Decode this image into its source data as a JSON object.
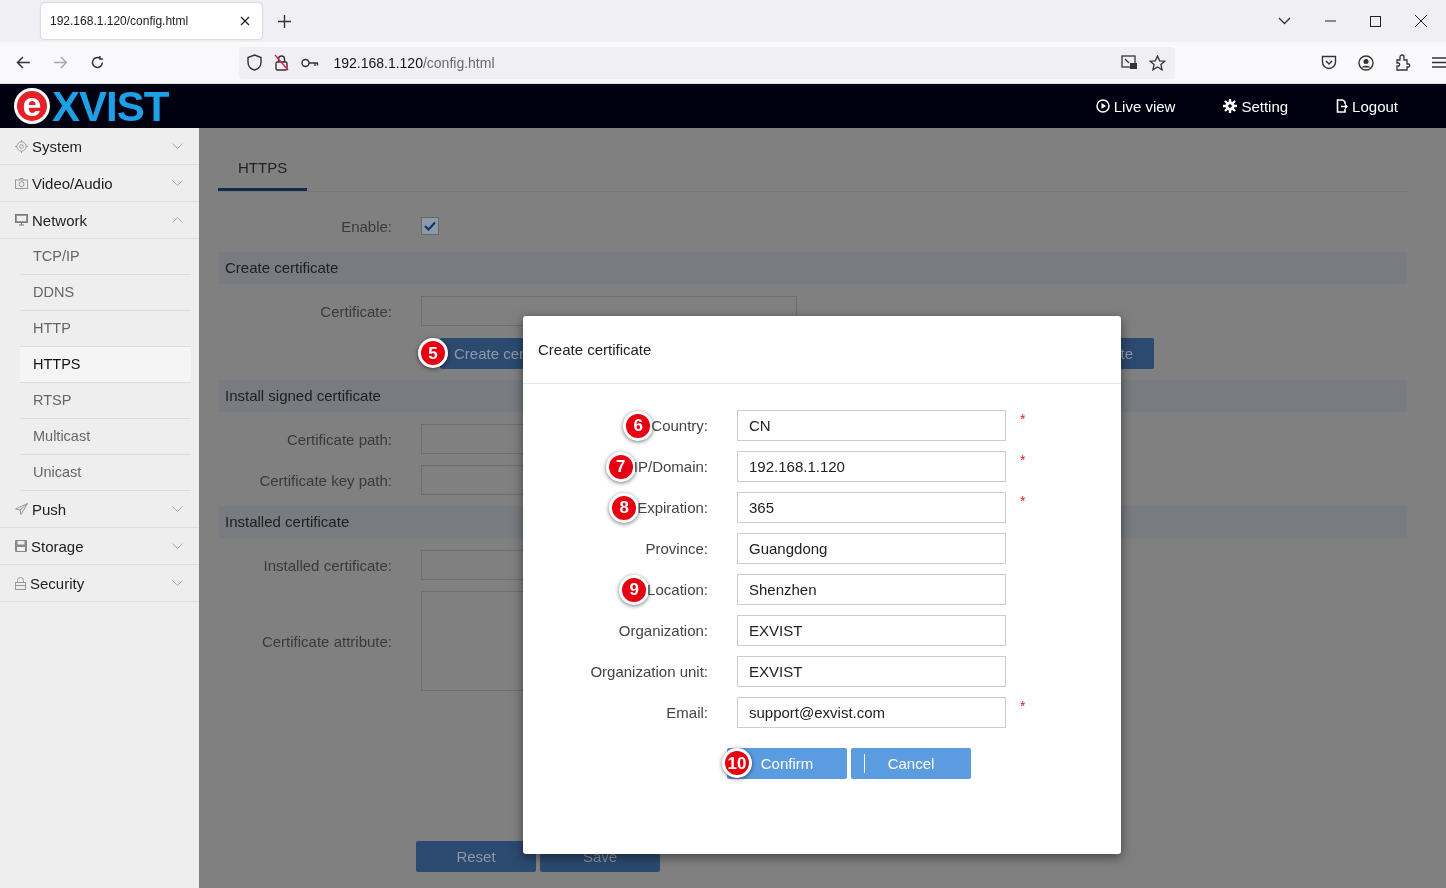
{
  "browser": {
    "tab_title": "192.168.1.120/config.html",
    "address_host": "192.168.1.120",
    "address_path": "/config.html"
  },
  "logo": {
    "mark": "e",
    "text": "XVIST"
  },
  "nav": [
    {
      "label": "Live view",
      "kind": "live"
    },
    {
      "label": "Setting",
      "kind": "setting"
    },
    {
      "label": "Logout",
      "kind": "logout"
    }
  ],
  "sidebar": [
    {
      "label": "System",
      "kind": "system",
      "expanded": false
    },
    {
      "label": "Video/Audio",
      "kind": "video",
      "expanded": false
    },
    {
      "label": "Network",
      "kind": "network",
      "expanded": true,
      "children": [
        {
          "label": "TCP/IP",
          "selected": false
        },
        {
          "label": "DDNS",
          "selected": false
        },
        {
          "label": "HTTP",
          "selected": false
        },
        {
          "label": "HTTPS",
          "selected": true
        },
        {
          "label": "RTSP",
          "selected": false
        },
        {
          "label": "Multicast",
          "selected": false
        },
        {
          "label": "Unicast",
          "selected": false
        }
      ]
    },
    {
      "label": "Push",
      "kind": "push",
      "expanded": false
    },
    {
      "label": "Storage",
      "kind": "storage",
      "expanded": false
    },
    {
      "label": "Security",
      "kind": "security",
      "expanded": false
    }
  ],
  "tabs": [
    {
      "label": "HTTPS",
      "selected": true
    }
  ],
  "enable": {
    "label": "Enable:",
    "checked": true
  },
  "sections": [
    {
      "title": "Create certificate",
      "rows": [
        {
          "label": "Certificate:",
          "kind": "input"
        }
      ],
      "buttons": [
        {
          "label": "Create cer",
          "badge": "5"
        },
        {
          "label": "te"
        }
      ]
    },
    {
      "title": "Install signed certificate",
      "rows": [
        {
          "label": "Certificate path:",
          "kind": "input"
        },
        {
          "label": "Certificate key path:",
          "kind": "input"
        }
      ]
    },
    {
      "title": "Installed certificate",
      "rows": [
        {
          "label": "Installed certificate:",
          "kind": "input"
        },
        {
          "label": "Certificate attribute:",
          "kind": "textarea"
        }
      ]
    }
  ],
  "footer_buttons": [
    "Reset",
    "Save"
  ],
  "dialog": {
    "title": "Create certificate",
    "fields": [
      {
        "label": "Country:",
        "value": "CN",
        "required": true,
        "badge": "6"
      },
      {
        "label": "IP/Domain:",
        "value": "192.168.1.120",
        "required": true,
        "badge": "7"
      },
      {
        "label": "Expiration:",
        "value": "365",
        "required": true,
        "badge": "8"
      },
      {
        "label": "Province:",
        "value": "Guangdong",
        "required": false
      },
      {
        "label": "Location:",
        "value": "Shenzhen",
        "required": false,
        "badge": "9"
      },
      {
        "label": "Organization:",
        "value": "EXVIST",
        "required": false
      },
      {
        "label": "Organization unit:",
        "value": "EXVIST",
        "required": false
      },
      {
        "label": "Email:",
        "value": "support@exvist.com",
        "required": true
      }
    ],
    "required_mark": "*",
    "buttons": [
      {
        "label": "Confirm",
        "badge": "10"
      },
      {
        "label": "Cancel"
      }
    ]
  }
}
